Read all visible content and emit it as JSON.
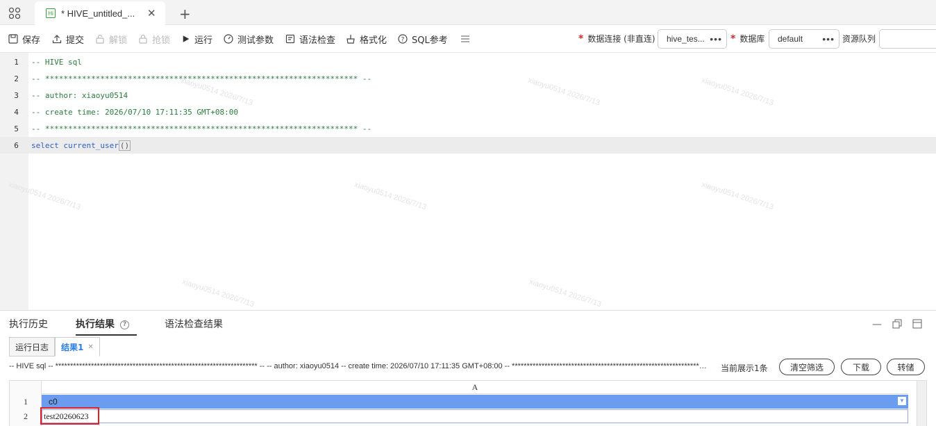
{
  "tabbar": {
    "tab_title": "* HIVE_untitled_...",
    "tab_icon_text": "Hi"
  },
  "toolbar": {
    "save": "保存",
    "submit": "提交",
    "unlock": "解锁",
    "grab_lock": "抢锁",
    "run": "运行",
    "test_params": "测试参数",
    "syntax_check": "语法检查",
    "format": "格式化",
    "sql_ref": "SQL参考",
    "data_conn_label": "数据连接 (非直连)",
    "data_conn_value": "hive_tes...",
    "database_label": "数据库",
    "database_value": "default",
    "queue_label": "资源队列"
  },
  "editor": {
    "lines": [
      {
        "n": "1",
        "text": "-- HIVE sql"
      },
      {
        "n": "2",
        "text": "-- ******************************************************************** --"
      },
      {
        "n": "3",
        "text": "-- author: xiaoyu0514"
      },
      {
        "n": "4",
        "text": "-- create time: 2026/07/10 17:11:35 GMT+08:00"
      },
      {
        "n": "5",
        "text": "-- ******************************************************************** --"
      },
      {
        "n": "6",
        "kw": "select",
        "fn": "current_user",
        "paren": "()"
      }
    ]
  },
  "watermark": "xiaoyu0514 2026/7/13",
  "panel": {
    "tab_history": "执行历史",
    "tab_results": "执行结果",
    "tab_syntax": "语法检查结果",
    "subtab_log": "运行日志",
    "subtab_result": "结果1",
    "query_text": "-- HIVE sql -- ******************************************************************** -- -- author: xiaoyu0514 -- create time: 2026/07/10 17:11:35 GMT+08:00 -- ******************************************************************** -- select current_user()",
    "row_count": "当前展示1条",
    "btn_clear_filter": "清空筛选",
    "btn_download": "下载",
    "btn_save_as": "转储"
  },
  "grid": {
    "column_letter": "A",
    "rows": [
      "1",
      "2"
    ],
    "header_cell": "c0",
    "data_cell": "test20260623"
  }
}
